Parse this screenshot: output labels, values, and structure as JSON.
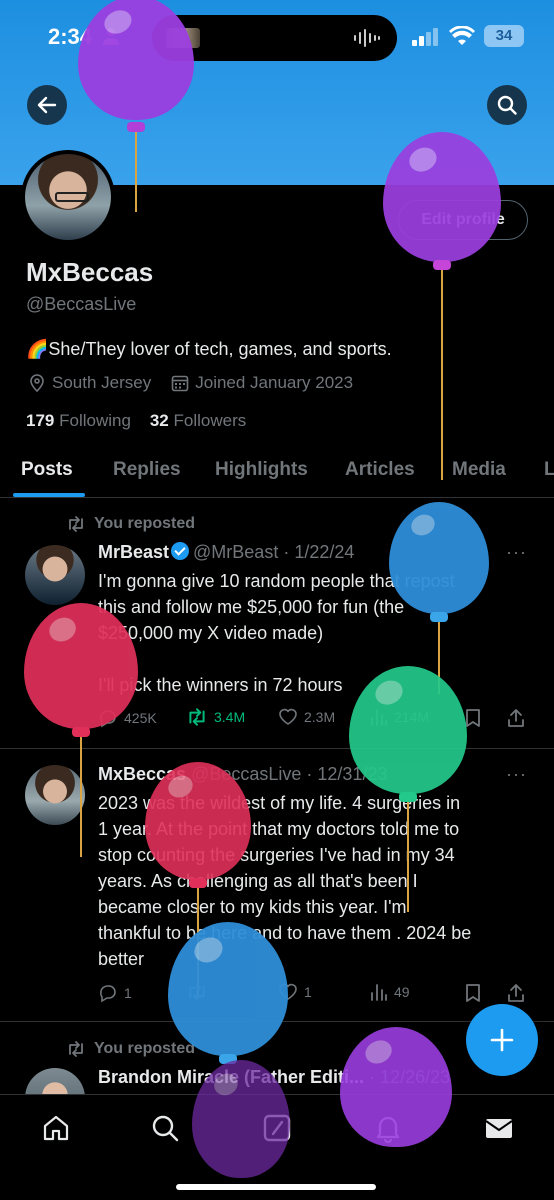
{
  "status_bar": {
    "time": "2:34",
    "battery": "34"
  },
  "profile": {
    "name": "MxBeccas",
    "handle": "@BeccasLive",
    "bio": "🌈She/They lover of tech, games, and sports.",
    "location": "South Jersey",
    "joined": "Joined January 2023",
    "following_count": "179",
    "following_label": "Following",
    "followers_count": "32",
    "followers_label": "Followers",
    "edit_label": "Edit profile"
  },
  "tabs": [
    "Posts",
    "Replies",
    "Highlights",
    "Articles",
    "Media",
    "L"
  ],
  "posts": [
    {
      "repost_label": "You reposted",
      "name": "MrBeast",
      "handle": "@MrBeast · 1/22/24",
      "verified": true,
      "text_lines": [
        "I'm gonna give 10 random people that repost",
        "this and follow me $25,000 for fun (the",
        "$250,000 my X video made)",
        "",
        "I'll pick the winners in 72 hours"
      ],
      "replies": "425K",
      "reposts": "3.4M",
      "likes": "2.3M",
      "views": "214M"
    },
    {
      "repost_label": "",
      "name": "MxBeccas",
      "handle": "@BeccasLive · 12/31/23",
      "verified": false,
      "text_lines": [
        "2023 was the wildest of my life. 4 surgeries in",
        "1 year. At the point that my doctors told me to",
        "stop counting the surgeries I've had in my 34",
        "years. As challenging as all that's been I",
        "became closer to my kids this year. I'm",
        "thankful to be here and to have them . 2024 be",
        "better"
      ],
      "replies": "1",
      "reposts": "",
      "likes": "1",
      "views": "49"
    },
    {
      "repost_label": "You reposted",
      "name": "Brandon Miracle (Father Editi...",
      "handle": "· 12/26/23",
      "verified": false
    }
  ],
  "colors": {
    "accent": "#1d9bf0",
    "banner": "#2f9be9",
    "repost_green": "#00ba7c",
    "muted": "#71767b"
  },
  "icons": [
    "back-arrow-icon",
    "search-icon",
    "location-icon",
    "calendar-icon",
    "repost-icon",
    "reply-icon",
    "like-icon",
    "views-icon",
    "bookmark-icon",
    "share-icon",
    "plus-icon",
    "home-icon",
    "compose-icon",
    "bell-icon",
    "mail-icon"
  ]
}
